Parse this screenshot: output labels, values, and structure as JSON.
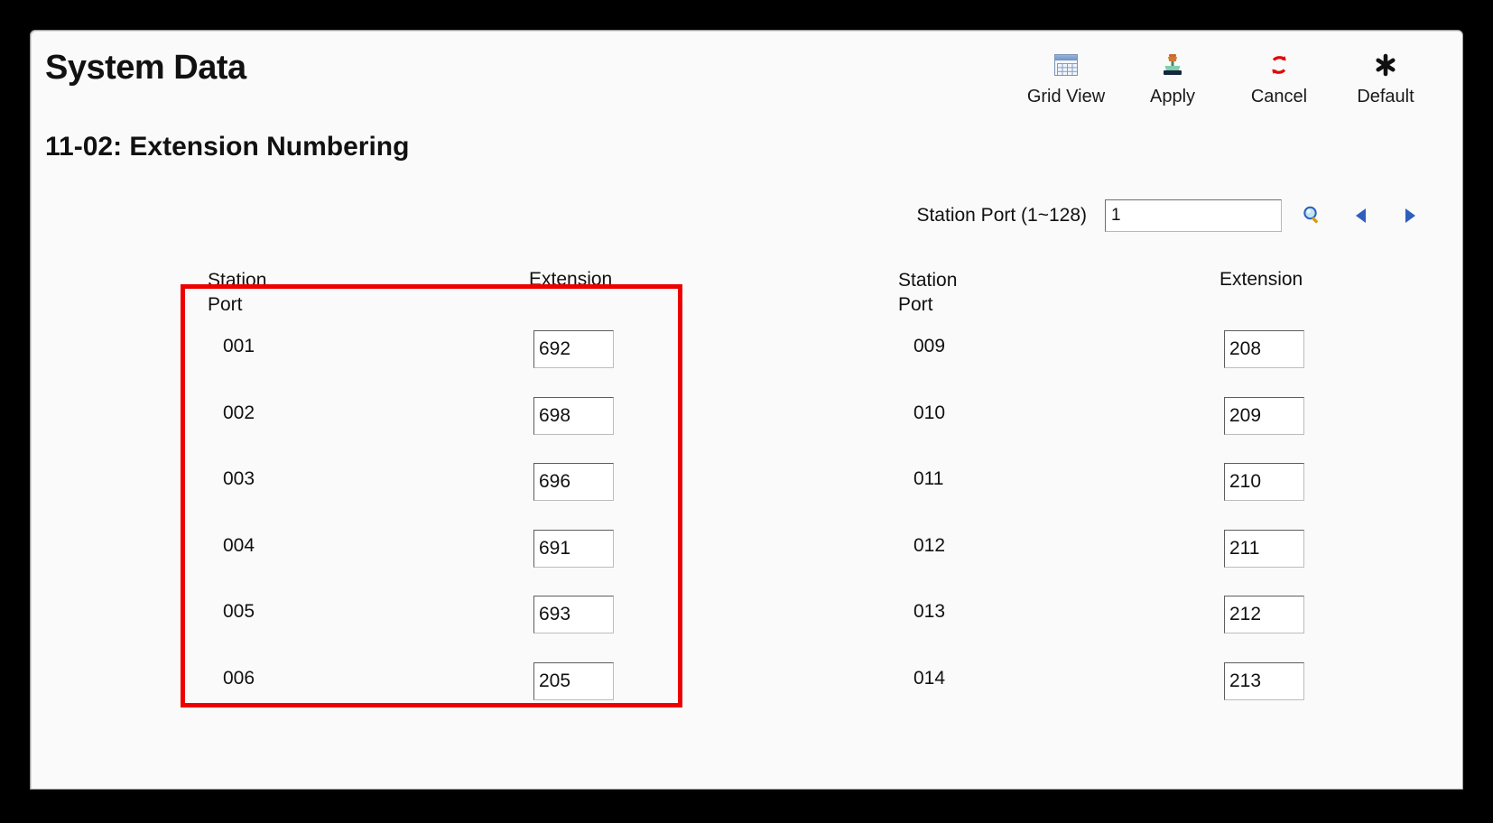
{
  "window": {
    "app_title": "System Data",
    "page_title": "11-02: Extension Numbering"
  },
  "toolbar": {
    "items": [
      {
        "label": "Grid View",
        "icon": "grid-table-icon"
      },
      {
        "label": "Apply",
        "icon": "rubber-stamp-icon"
      },
      {
        "label": "Cancel",
        "icon": "red-circular-arrows-icon"
      },
      {
        "label": "Default",
        "icon": "asterisk-icon"
      }
    ]
  },
  "search": {
    "label": "Station Port (1~128)",
    "value": "1",
    "placeholder": "",
    "search_icon": "magnifier-icon",
    "prev_icon": "triangle-left-icon",
    "next_icon": "triangle-right-icon"
  },
  "table": {
    "headers": {
      "port": "Station\nPort",
      "port_line1": "Station",
      "port_line2": "Port",
      "extension": "Extension"
    },
    "left_column": [
      {
        "port": "001",
        "extension": "692"
      },
      {
        "port": "002",
        "extension": "698"
      },
      {
        "port": "003",
        "extension": "696"
      },
      {
        "port": "004",
        "extension": "691"
      },
      {
        "port": "005",
        "extension": "693"
      },
      {
        "port": "006",
        "extension": "205"
      }
    ],
    "right_column": [
      {
        "port": "009",
        "extension": "208"
      },
      {
        "port": "010",
        "extension": "209"
      },
      {
        "port": "011",
        "extension": "210"
      },
      {
        "port": "012",
        "extension": "211"
      },
      {
        "port": "013",
        "extension": "212"
      },
      {
        "port": "014",
        "extension": "213"
      }
    ]
  },
  "annotation": {
    "color": "#ee0000",
    "description": "red highlight box around left column rows 001-005"
  },
  "colors": {
    "background": "#000000",
    "panel": "#fafafa",
    "text": "#111111",
    "annotation_red": "#ee0000",
    "grid_icon_blue": "#6f93c4",
    "cancel_red": "#dd0b0b",
    "arrow_blue": "#2f5fbd"
  }
}
